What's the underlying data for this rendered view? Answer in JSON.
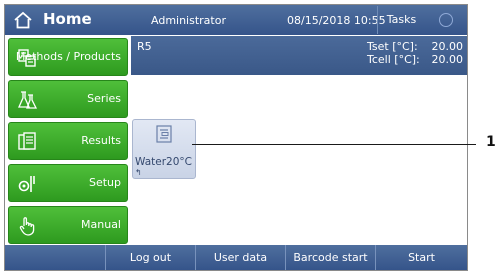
{
  "header": {
    "title": "Home",
    "user": "Administrator",
    "datetime": "08/15/2018 10:55",
    "tasks_label": "Tasks"
  },
  "sidebar": {
    "items": [
      {
        "label": "Methods / Products",
        "icon": "methods-icon"
      },
      {
        "label": "Series",
        "icon": "flasks-icon"
      },
      {
        "label": "Results",
        "icon": "results-icon"
      },
      {
        "label": "Setup",
        "icon": "setup-icon"
      },
      {
        "label": "Manual",
        "icon": "hand-icon"
      }
    ]
  },
  "main": {
    "method_name": "R5",
    "tset_label": "Tset [°C]:",
    "tset_value": "20.00",
    "tcell_label": "Tcell [°C]:",
    "tcell_value": "20.00"
  },
  "shortcut": {
    "label": "Water20°C",
    "icon": "method-list-icon"
  },
  "bottom_bar": {
    "buttons": [
      "Log out",
      "User data",
      "Barcode start",
      "Start"
    ]
  },
  "callout": {
    "number": "1"
  },
  "colors": {
    "header_blue": "#3f5f93",
    "button_green": "#3aa52a",
    "tile_bg": "#d6deee"
  }
}
